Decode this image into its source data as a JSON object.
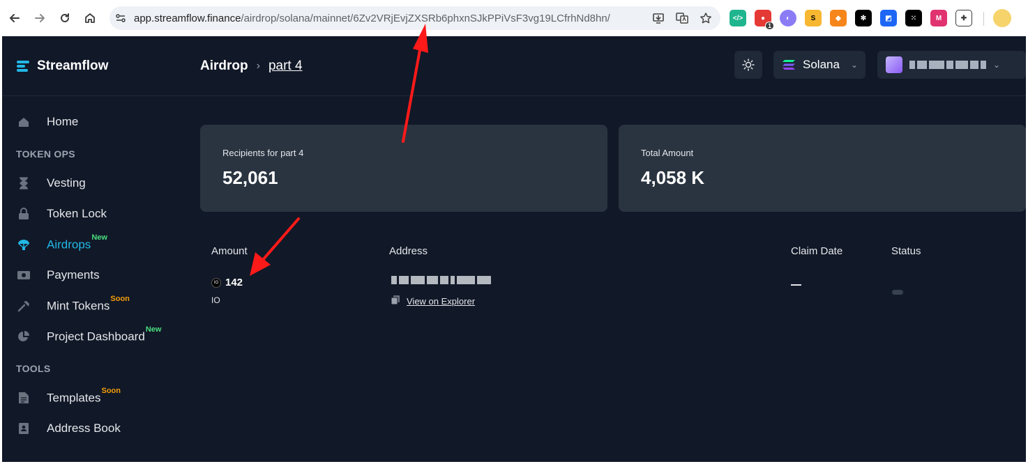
{
  "browser": {
    "url_host": "app.streamflow.finance",
    "url_path": "/airdrop/solana/mainnet/6Zv2VRjEvjZXSRb6phxnSJkPPiVsF3vg19LCfrhNd8hn/",
    "extension_badge": "1",
    "icons": [
      "back-icon",
      "forward-icon",
      "reload-icon",
      "home-icon",
      "site-info-icon",
      "install-icon",
      "translate-icon",
      "bookmark-star-icon",
      "extensions-icon"
    ]
  },
  "app": {
    "logo": "Streamflow",
    "breadcrumb": {
      "root": "Airdrop",
      "current": "part 4"
    },
    "network": "Solana",
    "sidebar": {
      "home": "Home",
      "section_token_ops": "TOKEN OPS",
      "vesting": "Vesting",
      "token_lock": "Token Lock",
      "airdrops": "Airdrops",
      "airdrops_badge": "New",
      "payments": "Payments",
      "mint_tokens": "Mint Tokens",
      "mint_tokens_badge": "Soon",
      "project_dashboard": "Project Dashboard",
      "project_dashboard_badge": "New",
      "section_tools": "TOOLS",
      "templates": "Templates",
      "templates_badge": "Soon",
      "address_book": "Address Book"
    },
    "stats": {
      "recipients_label": "Recipients for part 4",
      "recipients_value": "52,061",
      "total_label": "Total Amount",
      "total_value": "4,058 K"
    },
    "table": {
      "headers": {
        "amount": "Amount",
        "address": "Address",
        "claim_date": "Claim Date",
        "status": "Status"
      },
      "row": {
        "amount": "142",
        "token": "IO",
        "explorer_link": "View on Explorer"
      }
    },
    "accent_color": "#22b8e6"
  }
}
